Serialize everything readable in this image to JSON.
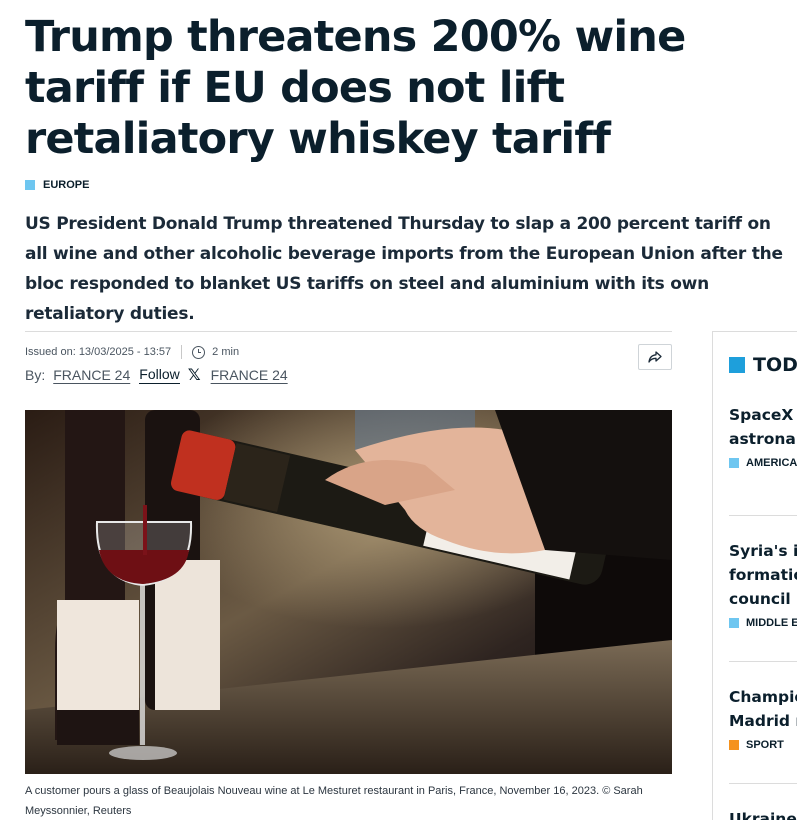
{
  "article": {
    "headline": "Trump threatens 200% wine tariff if EU does not lift retaliatory whiskey tariff",
    "kicker": "EUROPE",
    "lede": "US President Donald Trump threatened Thursday to slap a 200 percent tariff on all wine and other alcoholic beverage imports from the European Union after the bloc responded to blanket US tariffs on steel and aluminium with its own retaliatory duties.",
    "issued": "Issued on: 13/03/2025 - 13:57",
    "read_time": "2 min",
    "by_label": "By:",
    "author": "FRANCE 24",
    "follow_label": "Follow",
    "x_author": "FRANCE 24",
    "caption": "A customer pours a glass of Beaujolais Nouveau wine at Le Mesturet restaurant in Paris, France, November 16, 2023. © Sarah Meyssonnier, Reuters",
    "icons": [
      "clock-icon",
      "x-logo-icon",
      "share-icon"
    ],
    "accent_color": "#6ec6f0"
  },
  "sidebar": {
    "heading": "TODA",
    "items": [
      {
        "title_lines": [
          "SpaceX r",
          "astronau"
        ],
        "category": "AMERICA",
        "cat_color": "#6ec6f0"
      },
      {
        "title_lines": [
          "Syria's in",
          "formation",
          "council"
        ],
        "category": "MIDDLE E",
        "cat_color": "#6ec6f0"
      },
      {
        "title_lines": [
          "Champio",
          "Madrid re"
        ],
        "category": "SPORT",
        "cat_color": "#f5921e"
      },
      {
        "title_lines": [
          "Ukraine c"
        ],
        "category": "",
        "cat_color": "#6ec6f0"
      }
    ]
  }
}
